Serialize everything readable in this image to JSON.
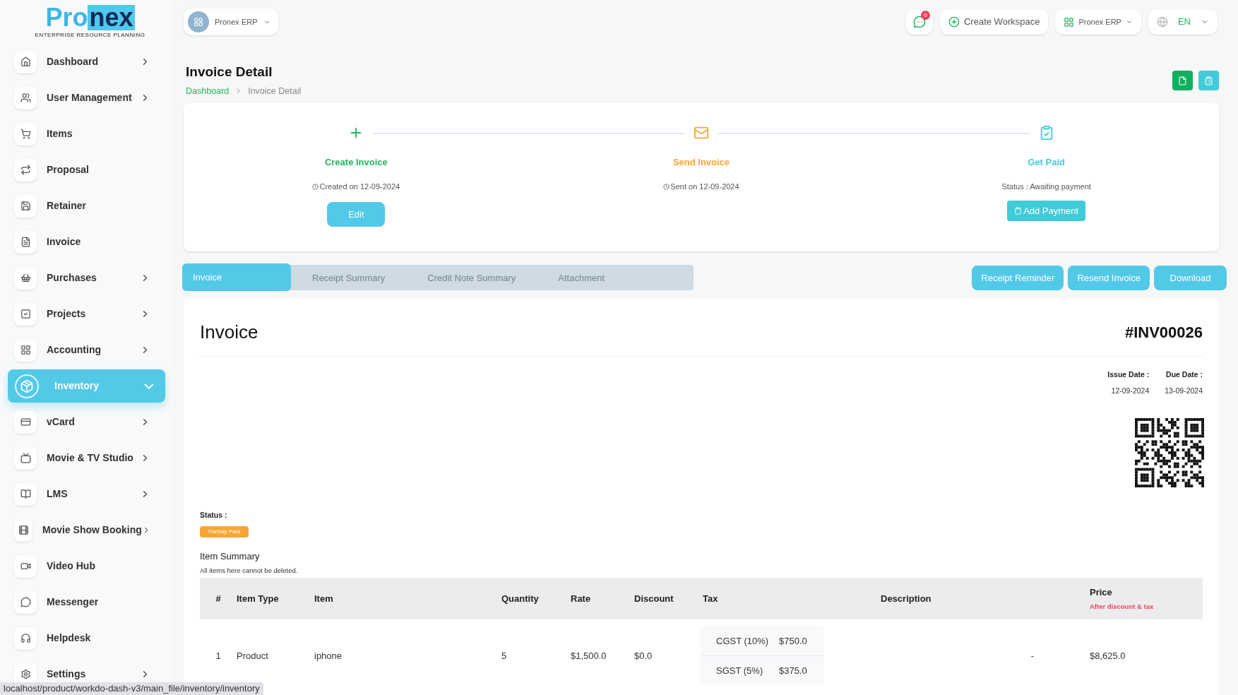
{
  "logo": {
    "part_1": "Pro",
    "part_2": "nex",
    "tagline": "ENTERPRISE RESOURCE PLANNING"
  },
  "sidebar": {
    "items": [
      {
        "label": "Dashboard",
        "has_submenu": true,
        "selected": false
      },
      {
        "label": "User Management",
        "has_submenu": true,
        "selected": false
      },
      {
        "label": "Items",
        "has_submenu": false,
        "selected": false
      },
      {
        "label": "Proposal",
        "has_submenu": false,
        "selected": false
      },
      {
        "label": "Retainer",
        "has_submenu": false,
        "selected": false
      },
      {
        "label": "Invoice",
        "has_submenu": false,
        "selected": false
      },
      {
        "label": "Purchases",
        "has_submenu": true,
        "selected": false
      },
      {
        "label": "Projects",
        "has_submenu": true,
        "selected": false
      },
      {
        "label": "Accounting",
        "has_submenu": true,
        "selected": false
      },
      {
        "label": "Inventory",
        "has_submenu": true,
        "selected": true
      },
      {
        "label": "vCard",
        "has_submenu": true,
        "selected": false
      },
      {
        "label": "Movie & TV Studio",
        "has_submenu": true,
        "selected": false
      },
      {
        "label": "LMS",
        "has_submenu": true,
        "selected": false
      },
      {
        "label": "Movie Show Booking",
        "has_submenu": true,
        "selected": false
      },
      {
        "label": "Video Hub",
        "has_submenu": false,
        "selected": false
      },
      {
        "label": "Messenger",
        "has_submenu": false,
        "selected": false
      },
      {
        "label": "Helpdesk",
        "has_submenu": false,
        "selected": false
      },
      {
        "label": "Settings",
        "has_submenu": true,
        "selected": false
      }
    ]
  },
  "header": {
    "workspace": "Pronex ERP",
    "message_count": "0",
    "create_workspace": "Create Workspace",
    "app_switcher": "Pronex ERP",
    "language": "EN"
  },
  "page": {
    "title": "Invoice Detail",
    "breadcrumb": [
      "Dashboard",
      "Invoice Detail"
    ]
  },
  "steps": [
    {
      "title": "Create Invoice",
      "note": "Created on 12-09-2024",
      "button": "Edit",
      "color": "#22b45e",
      "kind": "create"
    },
    {
      "title": "Send Invoice",
      "note": "Sent on 12-09-2024",
      "color": "#f7a534",
      "kind": "send"
    },
    {
      "title": "Get Paid",
      "note": "Status : Awaiting payment",
      "button": "Add Payment",
      "color": "#3fcbd9",
      "kind": "paid"
    }
  ],
  "tabs": [
    {
      "label": "Invoice",
      "selected": true
    },
    {
      "label": "Receipt Summary",
      "selected": false
    },
    {
      "label": "Credit Note Summary",
      "selected": false
    },
    {
      "label": "Attachment",
      "selected": false
    }
  ],
  "actions": [
    "Receipt Reminder",
    "Resend Invoice",
    "Download"
  ],
  "invoice": {
    "heading": "Invoice",
    "number": "#INV00026",
    "dates": [
      {
        "label": "Issue Date :",
        "value": "12-09-2024"
      },
      {
        "label": "Due Date :",
        "value": "13-09-2024"
      }
    ],
    "status_label": "Status :",
    "status": "Partialy Paid",
    "summary_title": "Item Summary",
    "summary_note": "All items here cannot be deleted.",
    "table": {
      "columns": [
        "#",
        "Item Type",
        "Item",
        "Quantity",
        "Rate",
        "Discount",
        "Tax",
        "Description",
        "Price"
      ],
      "price_note": "After discount & tax",
      "rows": [
        {
          "no": "1",
          "item_type": "Product",
          "item": "iphone",
          "quantity": "5",
          "rate": "$1,500.0",
          "discount": "$0.0",
          "taxes": [
            {
              "name": "CGST (10%)",
              "amount": "$750.0"
            },
            {
              "name": "SGST (5%)",
              "amount": "$375.0"
            }
          ],
          "description": "-",
          "price": "$8,625.0"
        }
      ]
    }
  },
  "status_bar": "localhost/product/workdo-dash-v3/main_file/inventory/inventory"
}
